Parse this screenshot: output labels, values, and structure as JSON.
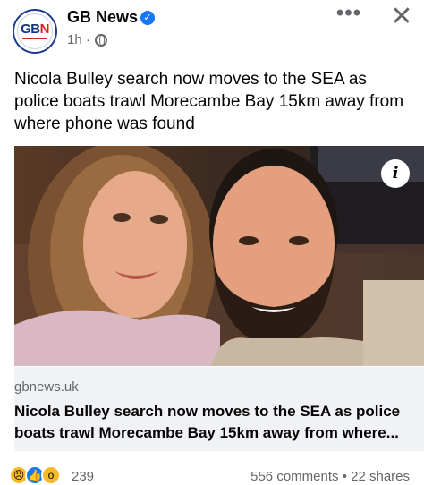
{
  "post": {
    "page_name": "GB News",
    "avatar_logo": "GBN",
    "time": "1h",
    "separator": "·",
    "more_label": "•••",
    "close_label": "✕",
    "text": "Nicola Bulley search now moves to the SEA as police boats trawl Morecambe Bay 15km away from where phone was found",
    "info_label": "i"
  },
  "link_preview": {
    "domain": "gbnews.uk",
    "title": "Nicola Bulley search now moves to the SEA as police boats trawl Morecambe Bay 15km away from where..."
  },
  "footer": {
    "reaction_count": "239",
    "comments": "556 comments",
    "dot": "•",
    "shares": "22 shares"
  },
  "icons": {
    "verified": "verified-badge-icon",
    "globe": "globe-icon",
    "more": "more-icon",
    "close": "close-icon",
    "info": "info-icon"
  },
  "colors": {
    "verified_blue": "#1877f2",
    "secondary_text": "#65676b",
    "link_bg": "#f0f2f5",
    "brand_navy": "#12367f",
    "brand_red": "#d2232a"
  }
}
